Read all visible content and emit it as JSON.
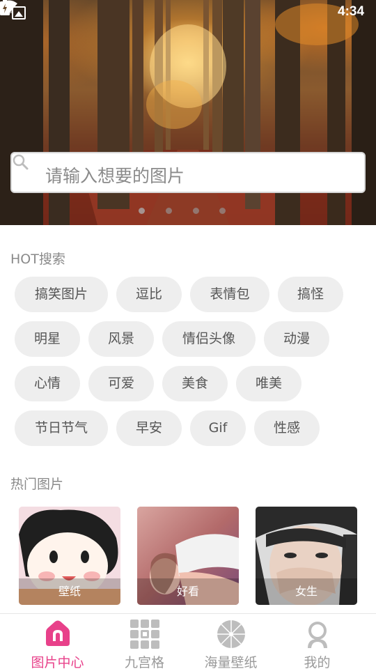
{
  "status_bar": {
    "time": "4:34",
    "icons": [
      "gallery-icon",
      "wifi-icon",
      "signal-icon",
      "battery-icon"
    ]
  },
  "search": {
    "placeholder": "请输入想要的图片"
  },
  "carousel": {
    "page_count": 4,
    "active_index": 0
  },
  "hot_search": {
    "title": "HOT搜索",
    "tags": [
      "搞笑图片",
      "逗比",
      "表情包",
      "搞怪",
      "明星",
      "风景",
      "情侣头像",
      "动漫",
      "心情",
      "可爱",
      "美食",
      "唯美",
      "节日节气",
      "早安",
      "Gif",
      "性感"
    ]
  },
  "hot_images": {
    "title": "热门图片",
    "items": [
      {
        "caption": "壁纸"
      },
      {
        "caption": "好看"
      },
      {
        "caption": "女生"
      }
    ]
  },
  "bottom_nav": {
    "items": [
      {
        "label": "图片中心",
        "icon": "home-icon",
        "active": true
      },
      {
        "label": "九宫格",
        "icon": "grid-icon",
        "active": false
      },
      {
        "label": "海量壁纸",
        "icon": "umbrella-icon",
        "active": false
      },
      {
        "label": "我的",
        "icon": "profile-icon",
        "active": false
      }
    ]
  },
  "colors": {
    "accent": "#e8418a",
    "tag_background": "#eeeeee",
    "muted_text": "#8a8a8a"
  }
}
